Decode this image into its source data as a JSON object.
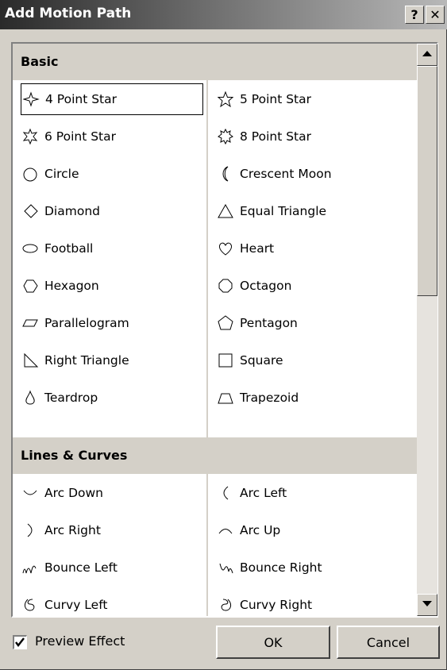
{
  "window": {
    "title": "Add Motion Path",
    "help_label": "?",
    "close_label": "✕"
  },
  "sections": [
    {
      "header": "Basic",
      "left": [
        {
          "label": "4 Point Star",
          "icon": "four-point-star-icon"
        },
        {
          "label": "6 Point Star",
          "icon": "six-point-star-icon"
        },
        {
          "label": "Circle",
          "icon": "circle-icon"
        },
        {
          "label": "Diamond",
          "icon": "diamond-icon"
        },
        {
          "label": "Football",
          "icon": "football-icon"
        },
        {
          "label": "Hexagon",
          "icon": "hexagon-icon"
        },
        {
          "label": "Parallelogram",
          "icon": "parallelogram-icon"
        },
        {
          "label": "Right Triangle",
          "icon": "right-triangle-icon"
        },
        {
          "label": "Teardrop",
          "icon": "teardrop-icon"
        }
      ],
      "right": [
        {
          "label": "5 Point Star",
          "icon": "five-point-star-icon"
        },
        {
          "label": "8 Point Star",
          "icon": "eight-point-star-icon"
        },
        {
          "label": "Crescent Moon",
          "icon": "crescent-moon-icon"
        },
        {
          "label": "Equal Triangle",
          "icon": "equal-triangle-icon"
        },
        {
          "label": "Heart",
          "icon": "heart-icon"
        },
        {
          "label": "Octagon",
          "icon": "octagon-icon"
        },
        {
          "label": "Pentagon",
          "icon": "pentagon-icon"
        },
        {
          "label": "Square",
          "icon": "square-icon"
        },
        {
          "label": "Trapezoid",
          "icon": "trapezoid-icon"
        }
      ]
    },
    {
      "header": "Lines & Curves",
      "left": [
        {
          "label": "Arc Down",
          "icon": "arc-down-icon"
        },
        {
          "label": "Arc Right",
          "icon": "arc-right-icon"
        },
        {
          "label": "Bounce Left",
          "icon": "bounce-left-icon"
        },
        {
          "label": "Curvy Left",
          "icon": "curvy-left-icon"
        }
      ],
      "right": [
        {
          "label": "Arc Left",
          "icon": "arc-left-icon"
        },
        {
          "label": "Arc Up",
          "icon": "arc-up-icon"
        },
        {
          "label": "Bounce Right",
          "icon": "bounce-right-icon"
        },
        {
          "label": "Curvy Right",
          "icon": "curvy-right-icon"
        }
      ]
    }
  ],
  "selected": "4 Point Star",
  "footer": {
    "preview_label": "Preview Effect",
    "preview_checked": true,
    "ok_label": "OK",
    "cancel_label": "Cancel"
  }
}
